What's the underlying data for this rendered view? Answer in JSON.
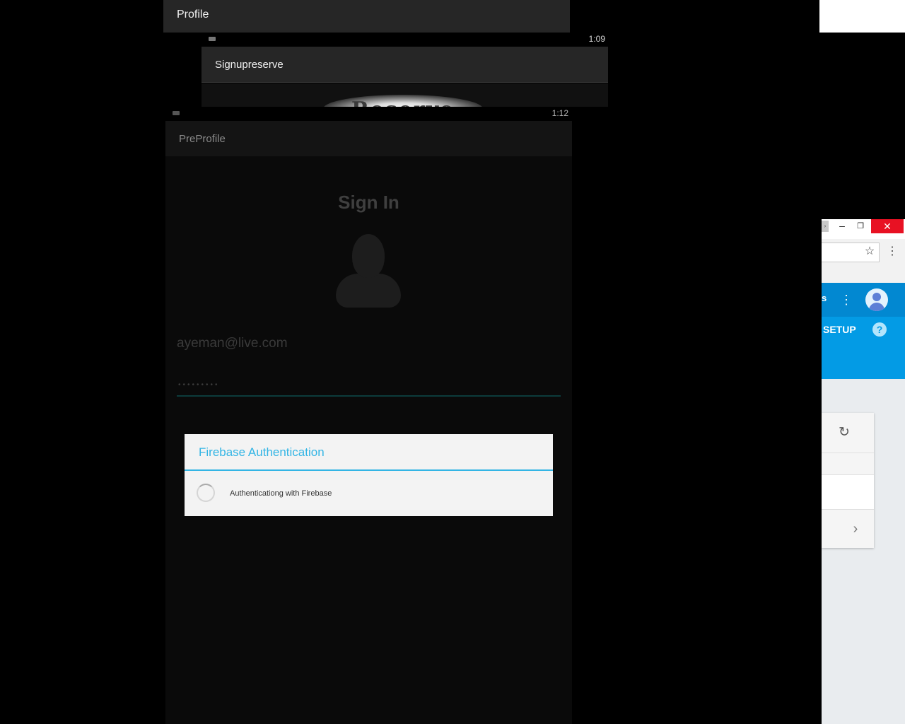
{
  "windows": {
    "profile": {
      "title": "Profile"
    },
    "signupreserve": {
      "title": "Signupreserve",
      "time": "1:09",
      "logo_text": "Reserve"
    },
    "preprofile": {
      "title": "PreProfile",
      "time": "1:12",
      "heading": "Sign In",
      "email_value": "ayeman@live.com",
      "password_mask": "•••••••••",
      "dialog": {
        "title": "Firebase Authentication",
        "message": "Authenticationg with Firebase"
      }
    }
  },
  "browser": {
    "nav_partial": "s",
    "setup_label": "SETUP",
    "help_label": "?",
    "window_controls": {
      "minimize": "–",
      "maximize": "❐",
      "close": "✕"
    },
    "star_icon": "☆",
    "kebab_icon": "⋮",
    "refresh_icon": "↻",
    "chevron_icon": "›",
    "accent_color": "#039be5"
  },
  "colors": {
    "dialog_accent": "#33b5e5",
    "close_red": "#e81123"
  }
}
